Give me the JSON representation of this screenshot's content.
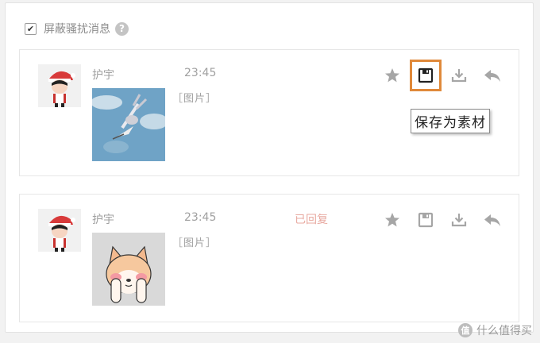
{
  "filter": {
    "checked": true,
    "check_glyph": "✔",
    "label": "屏蔽骚扰消息",
    "help_glyph": "?"
  },
  "messages": [
    {
      "sender": "护宇",
      "time": "23:45",
      "status": "",
      "image_label": "［图片］",
      "image_icon": "bunny-thumbnail",
      "actions": [
        "star-icon",
        "save-icon",
        "download-icon",
        "reply-icon"
      ]
    },
    {
      "sender": "护宇",
      "time": "23:45",
      "status": "已回复",
      "image_label": "［图片］",
      "image_icon": "shiba-dog-thumbnail",
      "actions": [
        "star-icon",
        "save-icon",
        "download-icon",
        "reply-icon"
      ]
    }
  ],
  "tooltip": {
    "text": "保存为素材"
  },
  "colors": {
    "icon_gray": "#a6a6a6",
    "highlight": "#e0893a",
    "status_replied": "#e8a9a0"
  },
  "watermark": {
    "logo_glyph": "值",
    "text": "什么值得买"
  }
}
